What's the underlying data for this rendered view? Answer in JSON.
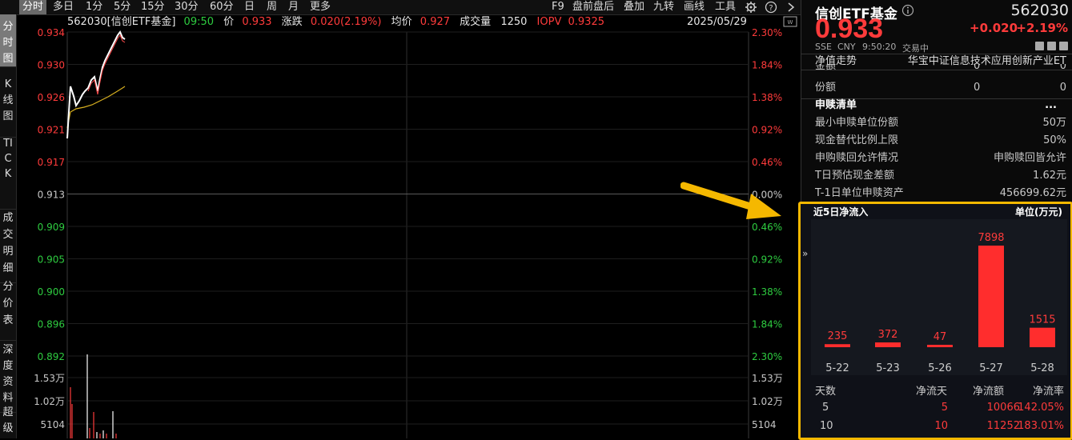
{
  "top_tabs": [
    "分时",
    "多日",
    "1分",
    "5分",
    "15分",
    "30分",
    "60分",
    "日",
    "周",
    "月",
    "更多"
  ],
  "top_right_tabs": [
    "F9",
    "盘前盘后",
    "叠加",
    "九转",
    "画线",
    "工具"
  ],
  "top_icons": {
    "settings": "gear-icon",
    "help": "help-icon",
    "collapse": "chevron-right-icon"
  },
  "side_tabs": [
    "分时图",
    "K线图",
    "TICK",
    "成交明细",
    "分价表",
    "深度资料",
    "超级"
  ],
  "info": {
    "code_name": "562030[信创ETF基金]",
    "time": "09:50",
    "price_label": "价",
    "price": "0.933",
    "change_label": "涨跌",
    "change": "0.020(2.19%)",
    "avg_label": "均价",
    "avg": "0.927",
    "vol_label": "成交量",
    "vol": "1250",
    "iopv_label": "IOPV",
    "iopv": "0.9325",
    "date": "2025/05/29"
  },
  "price_axis": {
    "left_labels": [
      "0.934",
      "0.930",
      "0.926",
      "0.921",
      "0.917",
      "0.913",
      "0.909",
      "0.905",
      "0.900",
      "0.896",
      "0.892"
    ],
    "right_labels": [
      "2.30%",
      "1.84%",
      "1.38%",
      "0.92%",
      "0.46%",
      "0.00%",
      "0.46%",
      "0.92%",
      "1.38%",
      "1.84%",
      "2.30%"
    ],
    "vol_labels_left": [
      "1.53万",
      "1.02万",
      "5104"
    ],
    "vol_labels_right": [
      "1.53万",
      "1.02万",
      "5104"
    ],
    "up_color": "#ff3b3b",
    "down_color": "#2ecc40",
    "flat_color": "#c8c8c8"
  },
  "header": {
    "name": "信创ETF基金",
    "code": "562030",
    "price": "0.933",
    "change": "+0.020",
    "change_pct": "+2.19%",
    "exchange": "SSE",
    "currency": "CNY",
    "time": "9:50:20",
    "status": "交易中"
  },
  "nav_row": {
    "label": "净值走势",
    "index_name": "华宝中证信息技术应用创新产业ET"
  },
  "info_rows": [
    {
      "label": "金额",
      "value": "0",
      "value2": "0"
    },
    {
      "label": "份额",
      "value": "0",
      "value2": "0"
    }
  ],
  "subscription": {
    "title": "申赎清单",
    "more": "...",
    "rows": [
      {
        "label": "最小申赎单位份额",
        "value": "50万"
      },
      {
        "label": "现金替代比例上限",
        "value": "50%"
      },
      {
        "label": "申购赎回允许情况",
        "value": "申购赎回皆允许"
      },
      {
        "label": "T日预估现金差额",
        "value": "1.62元"
      },
      {
        "label": "T-1日单位申赎资产",
        "value": "456699.62元"
      }
    ]
  },
  "net_inflow": {
    "title": "近5日净流入",
    "unit": "单位(万元)",
    "expand": "»",
    "bar_color": "#ff2d2d"
  },
  "chart_data": {
    "type": "bar",
    "title": "近5日净流入",
    "ylabel": "单位(万元)",
    "categories": [
      "5-22",
      "5-23",
      "5-26",
      "5-27",
      "5-28"
    ],
    "values": [
      235,
      372,
      47,
      7898,
      1515
    ],
    "ylim": [
      0,
      7898
    ]
  },
  "summary_table": {
    "headers": [
      "天数",
      "净流天",
      "净流额",
      "净流率"
    ],
    "rows": [
      [
        "5",
        "5",
        "10066",
        "142.05%"
      ],
      [
        "10",
        "10",
        "11252",
        "183.01%"
      ]
    ]
  }
}
